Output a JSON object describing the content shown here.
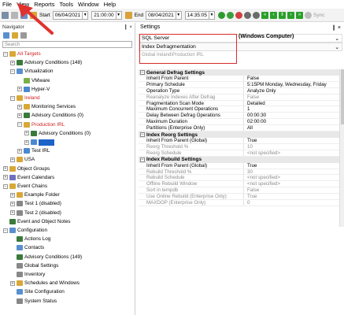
{
  "menu": [
    "File",
    "View",
    "Reports",
    "Tools",
    "Window",
    "Help"
  ],
  "toolbar": {
    "start_label": "Start",
    "start_date": "06/04/2021",
    "start_time": "21:00:00",
    "end_label": "End",
    "end_date": "08/04/2021",
    "end_time": "14:35:05",
    "sync_label": "Sync"
  },
  "navigator": {
    "title": "Navigator",
    "pin": "❙ ×",
    "search_placeholder": "Search",
    "items": [
      {
        "label": "All Targets",
        "level": 0,
        "exp": "−",
        "color": "red",
        "icon": "#d8a837"
      },
      {
        "label": "Advisory Conditions (148)",
        "level": 1,
        "exp": "+",
        "icon": "#3a7a3a"
      },
      {
        "label": "Virtualization",
        "level": 1,
        "exp": "−",
        "icon": "#5a8fcf"
      },
      {
        "label": "VMware",
        "level": 2,
        "exp": "",
        "icon": "#7ab04a"
      },
      {
        "label": "Hyper-V",
        "level": 2,
        "exp": "+",
        "icon": "#4a88d0"
      },
      {
        "label": "Ireland",
        "level": 1,
        "exp": "−",
        "color": "red",
        "icon": "#d8a837"
      },
      {
        "label": "Monitoring Services",
        "level": 2,
        "exp": "+",
        "icon": "#d8a837"
      },
      {
        "label": "Advisory Conditions (0)",
        "level": 2,
        "exp": "+",
        "icon": "#3a7a3a"
      },
      {
        "label": "Production IRL",
        "level": 2,
        "exp": "−",
        "color": "red",
        "icon": "#d8a837"
      },
      {
        "label": "Advisory Conditions (0)",
        "level": 3,
        "exp": "+",
        "icon": "#3a7a3a"
      },
      {
        "label": "",
        "level": 3,
        "exp": "+",
        "icon": "#4a88d0",
        "selected": true
      },
      {
        "label": "Test IRL",
        "level": 2,
        "exp": "+",
        "icon": "#4a88d0"
      },
      {
        "label": "USA",
        "level": 1,
        "exp": "+",
        "icon": "#d8a837"
      },
      {
        "label": "Object Groups",
        "level": 0,
        "exp": "+",
        "icon": "#d8a837"
      },
      {
        "label": "Event Calendars",
        "level": 0,
        "exp": "+",
        "icon": "#7070c0"
      },
      {
        "label": "Event Chains",
        "level": 0,
        "exp": "−",
        "icon": "#d8a837"
      },
      {
        "label": "Example Folder",
        "level": 1,
        "exp": "+",
        "icon": "#d8a837"
      },
      {
        "label": "Test 1 (disabled)",
        "level": 1,
        "exp": "+",
        "icon": "#888"
      },
      {
        "label": "Test 2 (disabled)",
        "level": 1,
        "exp": "+",
        "icon": "#888"
      },
      {
        "label": "Event and Object Notes",
        "level": 0,
        "exp": "",
        "icon": "#3a7a3a"
      },
      {
        "label": "Configuration",
        "level": 0,
        "exp": "−",
        "icon": "#5a8fcf"
      },
      {
        "label": "Actions Log",
        "level": 1,
        "exp": "",
        "icon": "#3a7a3a"
      },
      {
        "label": "Contacts",
        "level": 1,
        "exp": "",
        "icon": "#5a8fcf"
      },
      {
        "label": "Advisory Conditions (149)",
        "level": 1,
        "exp": "",
        "icon": "#3a7a3a"
      },
      {
        "label": "Global Settings",
        "level": 1,
        "exp": "",
        "icon": "#888"
      },
      {
        "label": "Inventory",
        "level": 1,
        "exp": "",
        "icon": "#888"
      },
      {
        "label": "Schedules and Windows",
        "level": 1,
        "exp": "+",
        "icon": "#d8a837"
      },
      {
        "label": "Site Configuration",
        "level": 1,
        "exp": "",
        "icon": "#5a8fcf"
      },
      {
        "label": "System Status",
        "level": 1,
        "exp": "",
        "icon": "#888"
      }
    ]
  },
  "settings": {
    "title": "Settings",
    "pin": "❙ ×",
    "window_title": "(Windows Computer)",
    "dropdown1": "SQL Server",
    "dropdown2": "Index Defragmentation",
    "global_setting": "Global Ireland\\Production IRL",
    "sections": [
      {
        "title": "General Defrag Settings",
        "rows": [
          {
            "k": "Inherit From Parent",
            "v": "False"
          },
          {
            "k": "Primary Schedule",
            "v": "5:15PM Monday, Wednesday, Friday"
          },
          {
            "k": "Operation Type",
            "v": "Analyze Only"
          },
          {
            "k": "Reanalyze Indexes After Defrag",
            "v": "False",
            "grey": true
          },
          {
            "k": "Fragmentation Scan Mode",
            "v": "Detailed"
          },
          {
            "k": "Maximum Concurrent Operations",
            "v": "1"
          },
          {
            "k": "Delay Between Defrag Operations",
            "v": "00:00:30"
          },
          {
            "k": "Maximum Duration",
            "v": "02:00:00"
          },
          {
            "k": "Partitions (Enterprise Only)",
            "v": "All"
          }
        ]
      },
      {
        "title": "Index Reorg Settings",
        "rows": [
          {
            "k": "Inherit From Parent (Global)",
            "v": "True"
          },
          {
            "k": "Reorg Threshold %",
            "v": "10",
            "grey": true
          },
          {
            "k": "Reorg Schedule",
            "v": "<not specified>",
            "grey": true
          }
        ]
      },
      {
        "title": "Index Rebuild Settings",
        "rows": [
          {
            "k": "Inherit From Parent (Global)",
            "v": "True"
          },
          {
            "k": "Rebuild Threshold %",
            "v": "30",
            "grey": true
          },
          {
            "k": "Rebuild Schedule",
            "v": "<not specified>",
            "grey": true
          },
          {
            "k": "Offline Rebuild Window",
            "v": "<not specified>",
            "grey": true
          },
          {
            "k": "Sort in tempdb",
            "v": "False",
            "grey": true
          },
          {
            "k": "Use Online Rebuild (Enterprise Only)",
            "v": "True",
            "grey": true
          },
          {
            "k": "MAXDOP (Enterprise Only)",
            "v": "0",
            "grey": true
          }
        ]
      }
    ]
  }
}
